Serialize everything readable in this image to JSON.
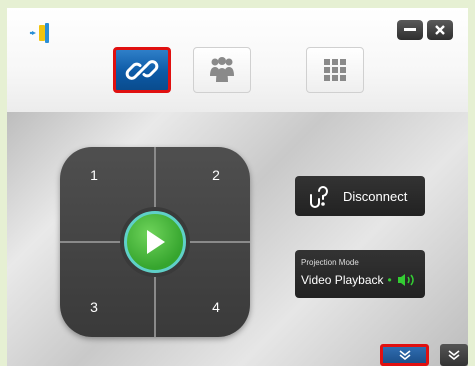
{
  "window": {
    "minimize_icon": "minimize-icon",
    "close_icon": "close-icon"
  },
  "tabs": [
    {
      "icon": "link-icon",
      "active": true
    },
    {
      "icon": "group-users-icon",
      "active": false
    },
    {
      "icon": "grid-icon",
      "active": false
    }
  ],
  "quad_pad": {
    "positions": [
      "1",
      "2",
      "3",
      "4"
    ],
    "play_icon": "play-icon"
  },
  "disconnect": {
    "label": "Disconnect",
    "icon": "broken-link-icon"
  },
  "projection": {
    "heading": "Projection Mode",
    "mode": "Video Playback",
    "dot": "•",
    "speaker_icon": "speaker-icon"
  },
  "footer": {
    "expand_icon": "double-chevron-down-icon",
    "collapse_icon": "double-chevron-down-icon"
  },
  "colors": {
    "accent_blue": "#0c5aa6",
    "highlight_red": "#e01010",
    "play_green": "#36a52e",
    "speaker_green": "#33cc33"
  }
}
